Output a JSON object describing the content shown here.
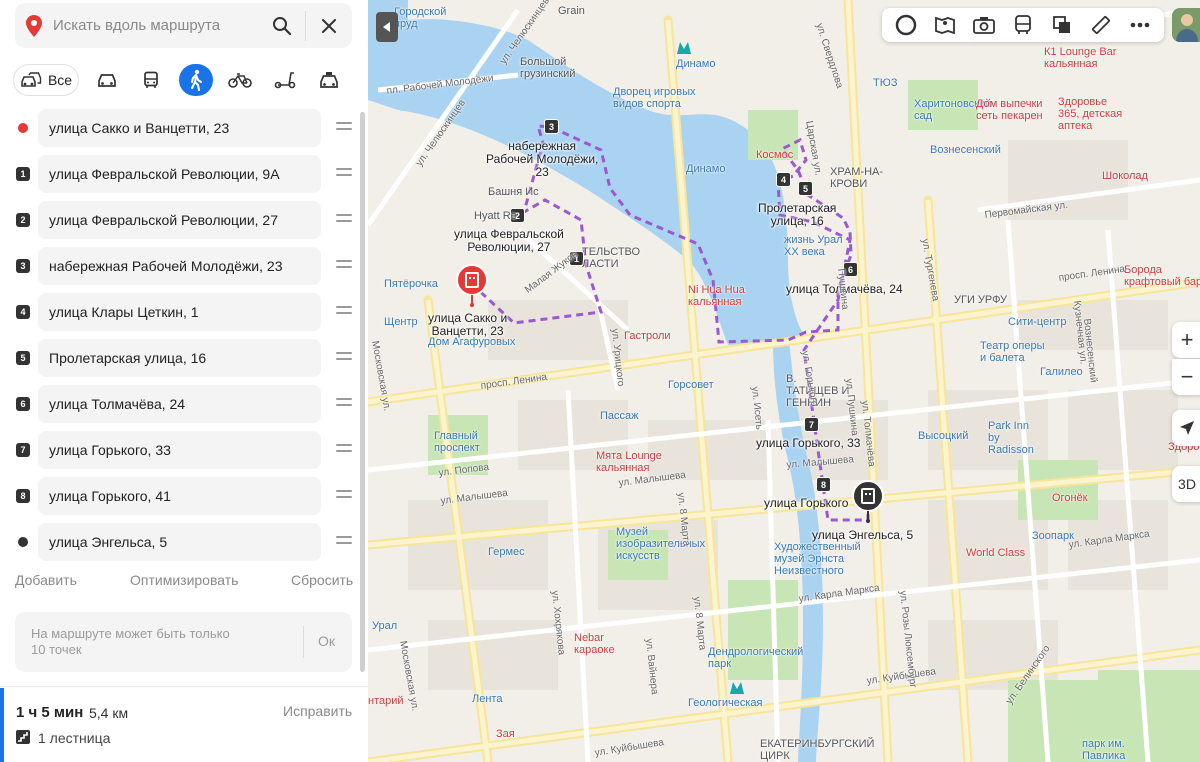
{
  "search": {
    "placeholder": "Искать вдоль маршрута"
  },
  "modes": {
    "all_label": "Все"
  },
  "waypoints": [
    {
      "marker": "red-dot",
      "label": "улица Сакко и Ванцетти, 23"
    },
    {
      "marker": "1",
      "label": "улица Февральской Революции, 9А"
    },
    {
      "marker": "2",
      "label": "улица Февральской Революции, 27"
    },
    {
      "marker": "3",
      "label": "набережная Рабочей Молодёжи, 23"
    },
    {
      "marker": "4",
      "label": "улица Клары Цеткин, 1"
    },
    {
      "marker": "5",
      "label": "Пролетарская улица, 16"
    },
    {
      "marker": "6",
      "label": "улица Толмачёва, 24"
    },
    {
      "marker": "7",
      "label": "улица Горького, 33"
    },
    {
      "marker": "8",
      "label": "улица Горького, 41"
    },
    {
      "marker": "dark-dot",
      "label": "улица Энгельса, 5"
    }
  ],
  "actions": {
    "add": "Добавить",
    "optimize": "Оптимизировать",
    "reset": "Сбросить"
  },
  "limit": {
    "text": "На маршруте может быть только 10 точек",
    "ok": "Ок"
  },
  "summary": {
    "time": "1 ч 5 мин",
    "distance": "5,4 км",
    "fix": "Исправить",
    "stairs": "1 лестница"
  },
  "colors": {
    "accent": "#1a73e8",
    "route": "#9b59d0",
    "start": "#e53935",
    "end": "#333333",
    "water": "#aad3f2",
    "park": "#c8e6b5"
  },
  "map": {
    "route_labels": [
      {
        "id": "r-start",
        "text": "улица Сакко и\nВанцетти, 23"
      },
      {
        "id": "r-2",
        "text": "улица Февральской\nРеволюции, 27"
      },
      {
        "id": "r-3",
        "text": "набережная\nРабочей Молодёжи,\n23"
      },
      {
        "id": "r-5",
        "text": "Пролетарская\nулица, 16"
      },
      {
        "id": "r-6",
        "text": "улица Толмачёва, 24"
      },
      {
        "id": "r-7",
        "text": "улица Горького, 33"
      },
      {
        "id": "r-8",
        "text": "улица Горького"
      },
      {
        "id": "r-end",
        "text": "улица Энгельса, 5"
      }
    ],
    "pois": [
      {
        "id": "p1",
        "text": "Городской\nпруд",
        "cls": "blue"
      },
      {
        "id": "p2",
        "text": "Grain"
      },
      {
        "id": "p3",
        "text": "Динамо",
        "cls": "blue"
      },
      {
        "id": "p4",
        "text": "Большой\nгрузинский"
      },
      {
        "id": "p5",
        "text": "Дворец игровых\nвидов спорта",
        "cls": "blue"
      },
      {
        "id": "p6",
        "text": "Динамо",
        "cls": "blue"
      },
      {
        "id": "p7",
        "text": "Hyatt Re"
      },
      {
        "id": "p8",
        "text": "Башня Ис"
      },
      {
        "id": "p9",
        "text": "Пятёрочка",
        "cls": "blue"
      },
      {
        "id": "p10",
        "text": "Дом Агафуровых",
        "cls": "blue"
      },
      {
        "id": "p11",
        "text": "Гастроли",
        "cls": "red"
      },
      {
        "id": "p12",
        "text": "Ni Hua Hua\nкальянная",
        "cls": "red"
      },
      {
        "id": "p13",
        "text": "Горсовет",
        "cls": "blue"
      },
      {
        "id": "p14",
        "text": "Пассаж",
        "cls": "blue"
      },
      {
        "id": "p15",
        "text": "Главный\nпроспект",
        "cls": "blue"
      },
      {
        "id": "p16",
        "text": "Мята Lounge\nкальянная",
        "cls": "red"
      },
      {
        "id": "p17",
        "text": "Музей\nизобразительных\nискусств",
        "cls": "blue"
      },
      {
        "id": "p18",
        "text": "Гермес",
        "cls": "blue"
      },
      {
        "id": "p19",
        "text": "Nebar\nкараоке",
        "cls": "red"
      },
      {
        "id": "p20",
        "text": "Дендрологический\nпарк",
        "cls": "blue"
      },
      {
        "id": "p21",
        "text": "Художественный\nмузей Эрнста\nНеизвестного",
        "cls": "blue"
      },
      {
        "id": "p22",
        "text": "Геологическая",
        "cls": "blue"
      },
      {
        "id": "p23",
        "text": "Лента",
        "cls": "blue"
      },
      {
        "id": "p24",
        "text": "Зая",
        "cls": "red"
      },
      {
        "id": "p25",
        "text": "ЕКАТЕРИНБУРГСКИЙ\nЦИРК"
      },
      {
        "id": "p26",
        "text": "К1 Lounge Bar\nкальянная",
        "cls": "red"
      },
      {
        "id": "p27",
        "text": "ТЮЗ",
        "cls": "blue"
      },
      {
        "id": "p28",
        "text": "Харитоновский\nсад",
        "cls": "blue"
      },
      {
        "id": "p29",
        "text": "Дом выпечки\nсеть пекарен",
        "cls": "red"
      },
      {
        "id": "p30",
        "text": "Здоровье\n365, детская\nаптека",
        "cls": "red"
      },
      {
        "id": "p31",
        "text": "Вознесенский",
        "cls": "blue"
      },
      {
        "id": "p32",
        "text": "ХРАМ-НА-\nКРОВИ"
      },
      {
        "id": "p33",
        "text": "Шоколад",
        "cls": "red"
      },
      {
        "id": "p34",
        "text": "УГИ УРФУ"
      },
      {
        "id": "p35",
        "text": "Борода\nкрафтовый бар",
        "cls": "red"
      },
      {
        "id": "p36",
        "text": "Сити-центр",
        "cls": "blue"
      },
      {
        "id": "p37",
        "text": "Театр оперы\nи балета",
        "cls": "blue"
      },
      {
        "id": "p38",
        "text": "Галилео",
        "cls": "blue"
      },
      {
        "id": "p39",
        "text": "Высоцкий",
        "cls": "blue"
      },
      {
        "id": "p40",
        "text": "Park Inn\nby\nRadisson",
        "cls": "blue"
      },
      {
        "id": "p41",
        "text": "Огонёк",
        "cls": "red"
      },
      {
        "id": "p42",
        "text": "Зоопарк",
        "cls": "blue"
      },
      {
        "id": "p43",
        "text": "World Class",
        "cls": "red"
      },
      {
        "id": "p44",
        "text": "парк им.\nПавлика\nМорозова",
        "cls": "blue"
      },
      {
        "id": "p45",
        "text": "Здоровь",
        "cls": "red"
      },
      {
        "id": "p46",
        "text": "Космос",
        "cls": "red"
      },
      {
        "id": "p47",
        "text": "ТЕЛЬСТВО\nЛАСТИ"
      },
      {
        "id": "p48",
        "text": "В.\nТАТИЩЕВ И\nГЕННИН"
      },
      {
        "id": "p49",
        "text": "жизнь Урал\nXX века",
        "cls": "blue"
      },
      {
        "id": "p50",
        "text": "Урал",
        "cls": "blue"
      },
      {
        "id": "p51",
        "text": "Щентр",
        "cls": "blue"
      },
      {
        "id": "p52",
        "text": "нтарий",
        "cls": "red"
      }
    ],
    "streets": [
      {
        "id": "s1",
        "text": "просп. Ленина"
      },
      {
        "id": "s2",
        "text": "просп. Ленина"
      },
      {
        "id": "s3",
        "text": "ул. Малышева"
      },
      {
        "id": "s4",
        "text": "ул. Малышева"
      },
      {
        "id": "s5",
        "text": "ул. Малышева"
      },
      {
        "id": "s6",
        "text": "ул. Куйбышева"
      },
      {
        "id": "s7",
        "text": "ул. Куйбышева"
      },
      {
        "id": "s8",
        "text": "ул. Карла Маркса"
      },
      {
        "id": "s9",
        "text": "ул. Карла Маркса"
      },
      {
        "id": "s10",
        "text": "Московская ул."
      },
      {
        "id": "s11",
        "text": "Московская ул."
      },
      {
        "id": "s12",
        "text": "ул. Челюскинцев"
      },
      {
        "id": "s13",
        "text": "ул. 8 Марта"
      },
      {
        "id": "s14",
        "text": "ул. 8 Марта"
      },
      {
        "id": "s15",
        "text": "ул. Попова"
      },
      {
        "id": "s16",
        "text": "ул. Хохрякова"
      },
      {
        "id": "s17",
        "text": "ул. Вайнера"
      },
      {
        "id": "s18",
        "text": "Первомайская ул."
      },
      {
        "id": "s19",
        "text": "ул. Пушкина"
      },
      {
        "id": "s20",
        "text": "ул. Толмачёва"
      },
      {
        "id": "s21",
        "text": "ул. Розы Люксембург"
      },
      {
        "id": "s22",
        "text": "ул. Белинского"
      },
      {
        "id": "s23",
        "text": "ул. Тургенева"
      },
      {
        "id": "s24",
        "text": "Царская ул."
      },
      {
        "id": "s25",
        "text": "ул. Урицкого"
      },
      {
        "id": "s26",
        "text": "пл. Рабочей Молодёжи"
      },
      {
        "id": "s27",
        "text": "ул. Свердлова"
      },
      {
        "id": "s28",
        "text": "ул. Челюскинцев"
      },
      {
        "id": "s29",
        "text": "ул. Горького"
      },
      {
        "id": "s30",
        "text": "Вознесенский"
      },
      {
        "id": "s31",
        "text": "Малая Жуков"
      },
      {
        "id": "s32",
        "text": "Пушкина"
      },
      {
        "id": "s33",
        "text": "ул. Исеть"
      },
      {
        "id": "s34",
        "text": "Кузнечная ул."
      }
    ],
    "controls": {
      "zoom_in": "+",
      "zoom_out": "−",
      "three_d": "3D"
    }
  }
}
